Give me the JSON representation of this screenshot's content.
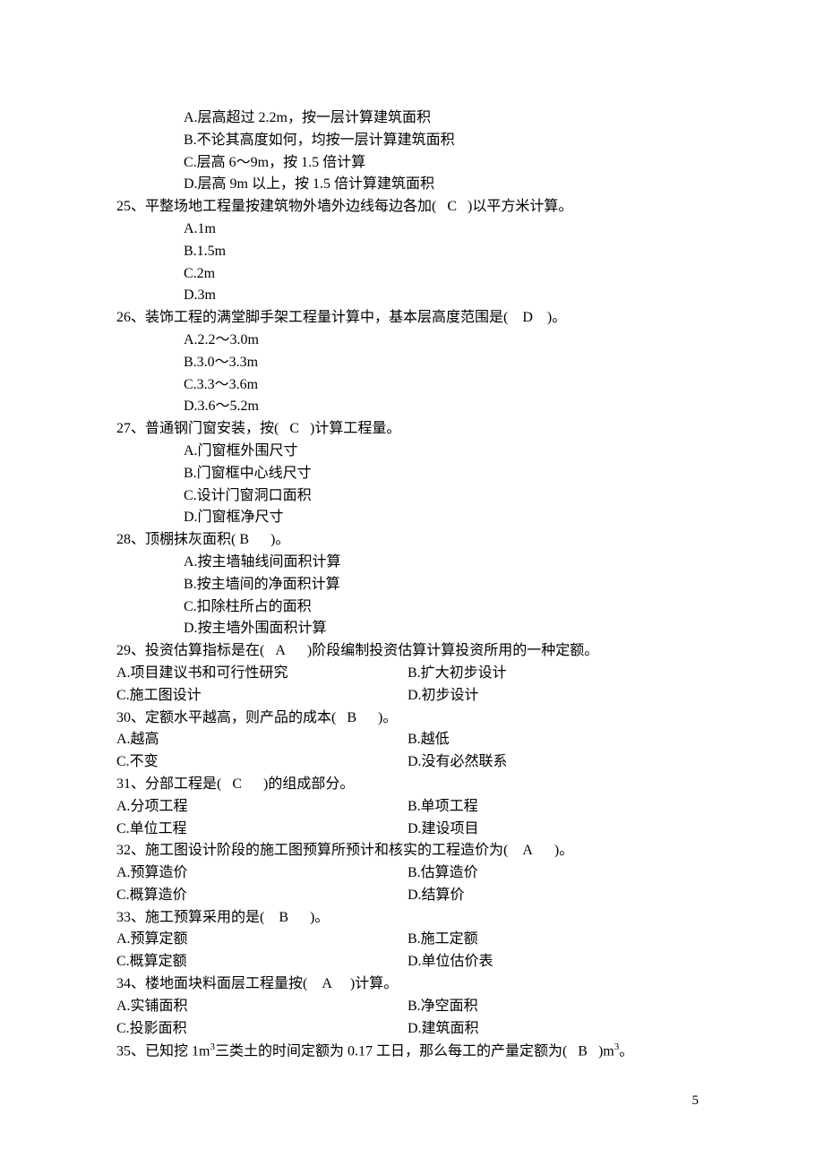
{
  "q24": {
    "optA": "A.层高超过 2.2m，按一层计算建筑面积",
    "optB": "B.不论其高度如何，均按一层计算建筑面积",
    "optC": "C.层高 6～9m，按 1.5 倍计算",
    "optD": "D.层高 9m 以上，按 1.5 倍计算建筑面积"
  },
  "q25": {
    "text_a": "25、平整场地工程量按建筑物外墙外边线每边各加(",
    "ans": "C",
    "text_b": ")以平方米计算。",
    "optA": "A.1m",
    "optB": "B.1.5m",
    "optC": "C.2m",
    "optD": "D.3m"
  },
  "q26": {
    "text_a": "26、装饰工程的满堂脚手架工程量计算中，基本层高度范围是(",
    "ans": "D",
    "text_b": ")。",
    "optA": "A.2.2～3.0m",
    "optB": "B.3.0～3.3m",
    "optC": "C.3.3～3.6m",
    "optD": "D.3.6～5.2m"
  },
  "q27": {
    "text_a": "27、普通钢门窗安装，按(",
    "ans": "C",
    "text_b": ")计算工程量。",
    "optA": "A.门窗框外围尺寸",
    "optB": "B.门窗框中心线尺寸",
    "optC": "C.设计门窗洞口面积",
    "optD": "D.门窗框净尺寸"
  },
  "q28": {
    "text_a": "28、顶棚抹灰面积(",
    "ans": "B",
    "text_b": ")。",
    "optA": "A.按主墙轴线间面积计算",
    "optB": "B.按主墙间的净面积计算",
    "optC": "C.扣除柱所占的面积",
    "optD": "D.按主墙外围面积计算"
  },
  "q29": {
    "text_a": "29、投资估算指标是在(",
    "ans": "A",
    "text_b": ")阶段编制投资估算计算投资所用的一种定额。",
    "optA": "A.项目建议书和可行性研究",
    "optB": "B.扩大初步设计",
    "optC": "C.施工图设计",
    "optD": "D.初步设计"
  },
  "q30": {
    "text_a": "30、定额水平越高，则产品的成本(",
    "ans": "B",
    "text_b": ")。",
    "optA": "A.越高",
    "optB": "B.越低",
    "optC": "C.不变",
    "optD": "D.没有必然联系"
  },
  "q31": {
    "text_a": "31、分部工程是(",
    "ans": "C",
    "text_b": ")的组成部分。",
    "optA": "A.分项工程",
    "optB": "B.单项工程",
    "optC": "C.单位工程",
    "optD": "D.建设项目"
  },
  "q32": {
    "text_a": "32、施工图设计阶段的施工图预算所预计和核实的工程造价为(",
    "ans": "A",
    "text_b": ")。",
    "optA": "A.预算造价",
    "optB": "B.估算造价",
    "optC": "C.概算造价",
    "optD": "D.结算价"
  },
  "q33": {
    "text_a": "33、施工预算采用的是(",
    "ans": "B",
    "text_b": ")。",
    "optA": "A.预算定额",
    "optB": "B.施工定额",
    "optC": "C.概算定额",
    "optD": "D.单位估价表"
  },
  "q34": {
    "text_a": "34、楼地面块料面层工程量按(",
    "ans": "A",
    "text_b": ")计算。",
    "optA": "A.实铺面积",
    "optB": "B.净空面积",
    "optC": "C.投影面积",
    "optD": "D.建筑面积"
  },
  "q35": {
    "text_a": "35、已知挖 1m",
    "text_a2": "三类土的时间定额为 0.17 工日，那么每工的产量定额为(",
    "ans": "B",
    "text_b": ")m",
    "text_b2": "。"
  },
  "page_number": "5"
}
